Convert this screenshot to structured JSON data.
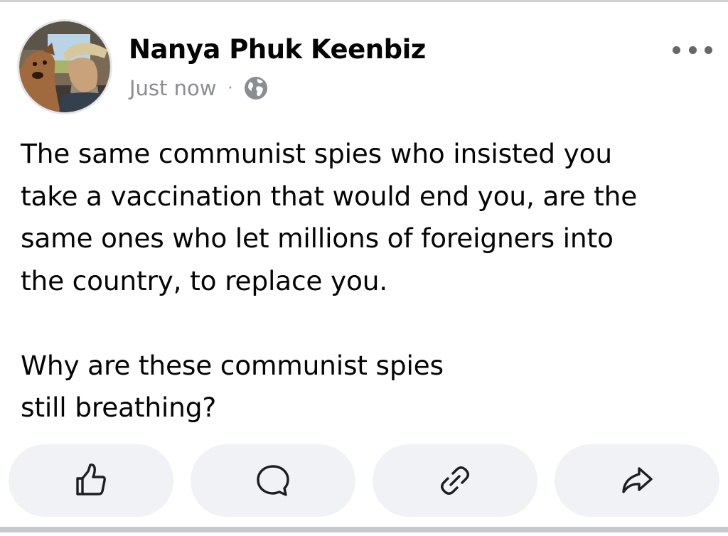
{
  "post": {
    "author_name": "Nanya Phuk Keenbiz",
    "timestamp": "Just now",
    "separator": "·",
    "privacy_icon": "globe-icon",
    "more_icon": "more-options-icon",
    "text": "The same communist spies who insisted you\ntake a vaccination that would end you, are the\nsame ones who let millions of foreigners into\nthe country, to replace you.\n\nWhy are these communist spies\nstill breathing?"
  },
  "actions": [
    {
      "icon": "like-icon"
    },
    {
      "icon": "comment-icon"
    },
    {
      "icon": "link-icon"
    },
    {
      "icon": "share-icon"
    }
  ],
  "colors": {
    "name_text": "#050505",
    "meta_text": "#8a8d91",
    "action_bg": "#f0f2f5",
    "icon_stroke": "#1c1e21"
  }
}
